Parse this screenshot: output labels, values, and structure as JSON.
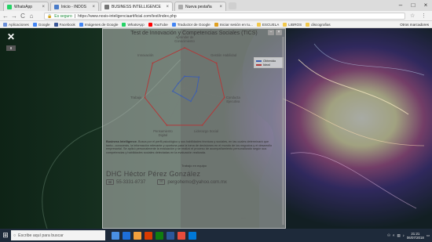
{
  "browser": {
    "tabs": [
      {
        "label": "WhatsApp",
        "color": "#25d366"
      },
      {
        "label": "Inicio - INDOS",
        "color": "#4a7cc9"
      },
      {
        "label": "BUSINESS INTELLIGENCE",
        "color": "#777777"
      },
      {
        "label": "Nueva pestaña",
        "color": "#aaaaaa"
      }
    ],
    "nav": {
      "back": "←",
      "forward": "→",
      "reload": "C",
      "home": "⌂"
    },
    "address": {
      "secure_label": "Es seguro",
      "url": "https://www.nosis-inteligenciaartificial.com/test/index.php"
    },
    "bookmarks": [
      {
        "label": "Aplicaciones",
        "color": "#6a8fd8"
      },
      {
        "label": "Google",
        "color": "#4285f4"
      },
      {
        "label": "Facebook",
        "color": "#3b5998"
      },
      {
        "label": "Imágenes de Google",
        "color": "#4285f4"
      },
      {
        "label": "WhatsApp",
        "color": "#25d366"
      },
      {
        "label": "YouTube",
        "color": "#ff0000"
      },
      {
        "label": "Traductor de Google",
        "color": "#4285f4"
      },
      {
        "label": "Iniciar sesión en tu...",
        "color": "#e0a020"
      },
      {
        "label": "ESCUELA",
        "color": "#f2c94c"
      },
      {
        "label": "LIBROS",
        "color": "#f2c94c"
      },
      {
        "label": "discografias",
        "color": "#f2c94c"
      }
    ],
    "bookmarks_right": "Otros marcadores"
  },
  "modal": {
    "title": "Test de Innovación y Competencias Sociales (TICS)",
    "description_bold": "Business Intelligence.",
    "description": "Busca por el perfil psicológico y sus habilidades técnicas y sociales, en las cuales determinará que tanto...conocerás, la información relevante y oportuna para la toma de decisiones en el mundo de los negocios y el desarrollo empresarial. Se aplicó personalmente la evaluación y se realizó el proceso de acompañamiento personalizado según sus competencias y habilidades sociales detectadas en la evaluación realizada.",
    "subcaption": "Trabajo en equipo",
    "signature_name": "DHC Héctor Pérez González",
    "phone": "55-3331-8737",
    "email": "pergohemo@yahoo.com.mx",
    "scroll_note": "....."
  },
  "page_icons": {
    "close": "✕",
    "badge": "Ⅲ"
  },
  "chart_data": {
    "type": "radar",
    "axes": [
      "Aprender de Conocimiento",
      "Gestión Habilidad",
      "Conducta Ejecutiva",
      "Liderazgo Social",
      "Pensamiento Digital",
      "Trabajo",
      "Innovación"
    ],
    "ylim": [
      0,
      10
    ],
    "series": [
      {
        "name": "Obtenido",
        "color": "#3e5fb0",
        "values": [
          3,
          4.5,
          3,
          3.5,
          2,
          3,
          2
        ]
      },
      {
        "name": "Ideal",
        "color": "#b03a3a",
        "values": [
          10,
          10,
          10,
          10,
          10,
          10,
          10
        ]
      }
    ],
    "legend_position": "top-right"
  },
  "taskbar": {
    "search_placeholder": "Escribe aquí para buscar",
    "time": "21:21",
    "date": "06/07/2018",
    "apps": [
      "#4a90e2",
      "#1e6fd9",
      "#f2a03d",
      "#d83b01",
      "#107c10",
      "#2b579a",
      "#e74c3c",
      "#0078d7"
    ]
  }
}
